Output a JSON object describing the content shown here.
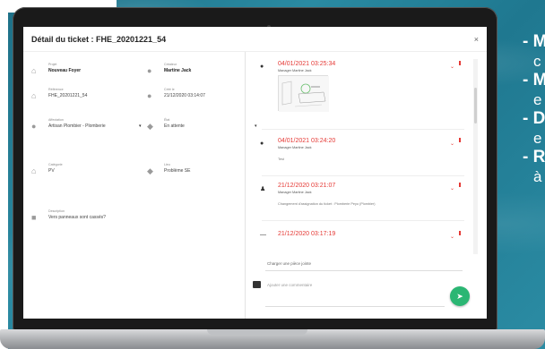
{
  "modal": {
    "title": "Détail du ticket : FHE_20201221_54",
    "close": "×"
  },
  "details": {
    "projet": {
      "label": "Projet",
      "value": "Nouveau Foyer"
    },
    "createur": {
      "label": "Créateur",
      "value": "Martine Jack"
    },
    "reference": {
      "label": "Référence",
      "value": "FHE_20201221_54"
    },
    "cree_le": {
      "label": "Créé le",
      "value": "21/12/2020 03:14:07"
    },
    "affectation": {
      "label": "Affectation",
      "value": "Artisan Plombier - Plomberie"
    },
    "etat": {
      "label": "État",
      "value": "En attente"
    },
    "categorie": {
      "label": "Catégorie",
      "value": "PV"
    },
    "lieu": {
      "label": "Lieu",
      "value": "Problème SE"
    },
    "description": {
      "label": "Description",
      "value": "Vers panneaux sont cassés?"
    }
  },
  "timeline": [
    {
      "date": "04/01/2021 03:25:34",
      "author": "Manager Martine Jack",
      "text": "",
      "has_image": true,
      "icon": "comment-icon"
    },
    {
      "date": "04/01/2021 03:24:20",
      "author": "Manager Martine Jack",
      "text": "Test",
      "has_image": false,
      "icon": "comment-icon"
    },
    {
      "date": "21/12/2020 03:21:07",
      "author": "Manager Martine Jack",
      "text": "Changement d'assignation du ticket : Plomberie Peyo (Plombier)",
      "has_image": false,
      "icon": "user-assign-icon"
    },
    {
      "date": "21/12/2020 03:17:19",
      "author": "",
      "text": "",
      "has_image": false,
      "icon": "dash-icon"
    }
  ],
  "attach": {
    "label": "Charger une pièce jointe"
  },
  "comment": {
    "placeholder": "Ajouter une commentaire"
  },
  "side_text": [
    "- M",
    "c",
    "- M",
    "e",
    "- D",
    "e",
    "- R",
    "à"
  ],
  "colors": {
    "accent": "#e53935",
    "send": "#2bb673"
  }
}
